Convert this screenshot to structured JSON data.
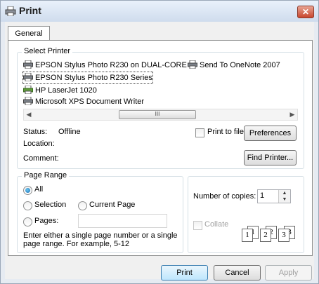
{
  "window": {
    "title": "Print",
    "close_glyph": "✕"
  },
  "tabs": [
    {
      "label": "General"
    }
  ],
  "select_printer": {
    "label": "Select Printer",
    "printers": [
      {
        "name": "EPSON Stylus Photo R230 on DUAL-CORE",
        "icon": "printer-icon"
      },
      {
        "name": "Send To OneNote 2007",
        "icon": "printer-icon"
      },
      {
        "name": "EPSON Stylus Photo R230 Series",
        "icon": "printer-icon",
        "selected": true
      },
      {
        "name": "HP LaserJet 1020",
        "icon": "printer-default-icon"
      },
      {
        "name": "Microsoft XPS Document Writer",
        "icon": "printer-icon"
      }
    ],
    "scroll_thumb_glyph": "III",
    "status_label": "Status:",
    "status_value": "Offline",
    "location_label": "Location:",
    "location_value": "",
    "comment_label": "Comment:",
    "comment_value": "",
    "print_to_file_label": "Print to file",
    "preferences_label": "Preferences",
    "find_printer_label": "Find Printer..."
  },
  "page_range": {
    "label": "Page Range",
    "all_label": "All",
    "selection_label": "Selection",
    "current_page_label": "Current Page",
    "pages_label": "Pages:",
    "pages_value": "",
    "hint": "Enter either a single page number or a single page range.  For example, 5-12"
  },
  "copies": {
    "number_label": "Number of copies:",
    "number_value": "1",
    "collate_label": "Collate",
    "collate_pages": [
      "1",
      "1",
      "2",
      "2",
      "3",
      "3"
    ]
  },
  "footer": {
    "print_label": "Print",
    "cancel_label": "Cancel",
    "apply_label": "Apply"
  }
}
